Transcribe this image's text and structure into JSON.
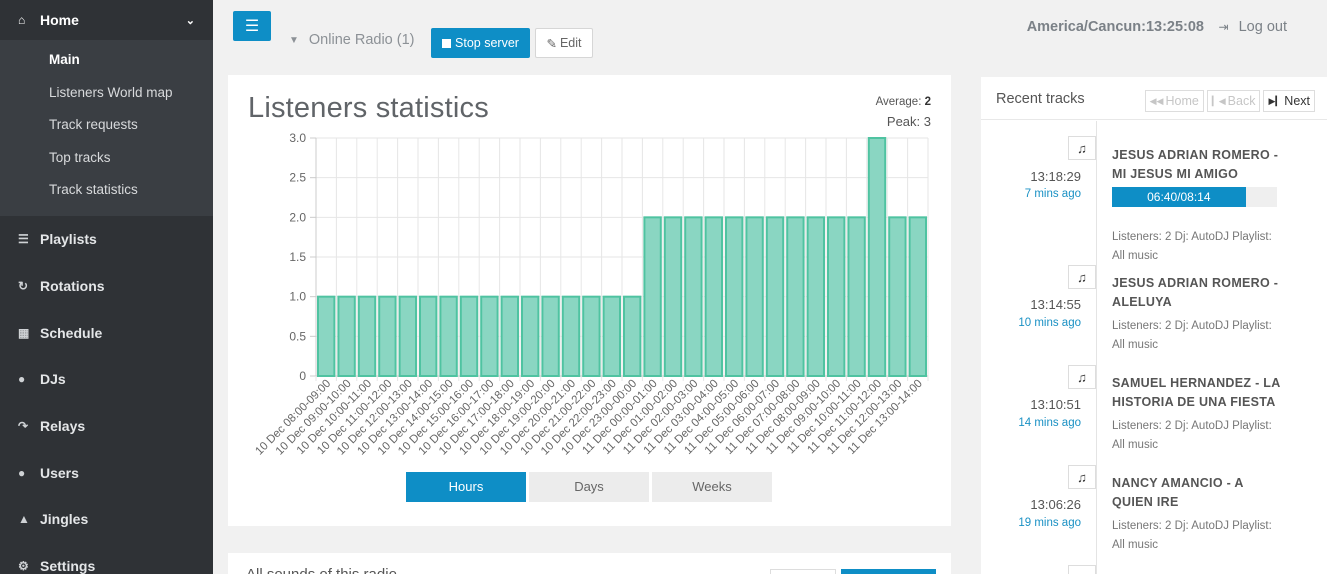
{
  "sidebar": {
    "home_label": "Home",
    "sub_items": [
      {
        "label": "Main"
      },
      {
        "label": "Listeners World map"
      },
      {
        "label": "Track requests"
      },
      {
        "label": "Top tracks"
      },
      {
        "label": "Track statistics"
      }
    ],
    "items": [
      {
        "label": "Playlists",
        "icon": "list-icon"
      },
      {
        "label": "Rotations",
        "icon": "refresh-icon"
      },
      {
        "label": "Schedule",
        "icon": "calendar-icon"
      },
      {
        "label": "DJs",
        "icon": "user-icon"
      },
      {
        "label": "Relays",
        "icon": "redo-icon"
      },
      {
        "label": "Users",
        "icon": "users-icon"
      },
      {
        "label": "Jingles",
        "icon": "bell-icon"
      },
      {
        "label": "Settings",
        "icon": "gears-icon"
      }
    ]
  },
  "header": {
    "radio_selector": "Online Radio (1)",
    "stop_label": "Stop server",
    "edit_label": "Edit",
    "timezone_clock": "America/Cancun:13:25:08",
    "logout_label": "Log out"
  },
  "stats": {
    "title": "Listeners statistics",
    "average_label": "Average:",
    "average_value": "2",
    "peak_text": "Peak: 3",
    "range_buttons": [
      "Hours",
      "Days",
      "Weeks"
    ],
    "active_range": "Hours"
  },
  "chart_data": {
    "type": "bar",
    "categories": [
      "10 Dec 08:00-09:00",
      "10 Dec 09:00-10:00",
      "10 Dec 10:00-11:00",
      "10 Dec 11:00-12:00",
      "10 Dec 12:00-13:00",
      "10 Dec 13:00-14:00",
      "10 Dec 14:00-15:00",
      "10 Dec 15:00-16:00",
      "10 Dec 16:00-17:00",
      "10 Dec 17:00-18:00",
      "10 Dec 18:00-19:00",
      "10 Dec 19:00-20:00",
      "10 Dec 20:00-21:00",
      "10 Dec 21:00-22:00",
      "10 Dec 22:00-23:00",
      "10 Dec 23:00-00:00",
      "11 Dec 00:00-01:00",
      "11 Dec 01:00-02:00",
      "11 Dec 02:00-03:00",
      "11 Dec 03:00-04:00",
      "11 Dec 04:00-05:00",
      "11 Dec 05:00-06:00",
      "11 Dec 06:00-07:00",
      "11 Dec 07:00-08:00",
      "11 Dec 08:00-09:00",
      "11 Dec 09:00-10:00",
      "11 Dec 10:00-11:00",
      "11 Dec 11:00-12:00",
      "11 Dec 12:00-13:00",
      "11 Dec 13:00-14:00"
    ],
    "values": [
      1,
      1,
      1,
      1,
      1,
      1,
      1,
      1,
      1,
      1,
      1,
      1,
      1,
      1,
      1,
      1,
      2,
      2,
      2,
      2,
      2,
      2,
      2,
      2,
      2,
      2,
      2,
      3,
      2,
      2
    ],
    "yticks": [
      "0",
      "0.5",
      "1.0",
      "1.5",
      "2.0",
      "2.5",
      "3.0"
    ],
    "ylim": [
      0,
      3
    ],
    "grid": true,
    "bar_fill": "#8ad6c2",
    "bar_stroke": "#4fc3a1"
  },
  "lower_panel": {
    "title": "All sounds of this radio"
  },
  "recent": {
    "title": "Recent tracks",
    "nav": [
      {
        "label": "Home",
        "icon": "fast-backward-icon",
        "enabled": false
      },
      {
        "label": "Back",
        "icon": "step-backward-icon",
        "enabled": false
      },
      {
        "label": "Next",
        "icon": "step-forward-icon",
        "enabled": true
      }
    ],
    "tracks": [
      {
        "time": "13:18:29",
        "ago": "7 mins ago",
        "name": "JESUS ADRIAN ROMERO - MI JESUS MI AMIGO",
        "progress_text": "06:40/08:14",
        "progress": 0.81,
        "meta": "Listeners: 2 Dj: AutoDJ Playlist: All music"
      },
      {
        "time": "13:14:55",
        "ago": "10 mins ago",
        "name": "JESUS ADRIAN ROMERO - ALELUYA",
        "meta": "Listeners: 2 Dj: AutoDJ Playlist: All music"
      },
      {
        "time": "13:10:51",
        "ago": "14 mins ago",
        "name": "SAMUEL HERNANDEZ - LA HISTORIA DE UNA FIESTA",
        "meta": "Listeners: 2 Dj: AutoDJ Playlist: All music"
      },
      {
        "time": "13:06:26",
        "ago": "19 mins ago",
        "name": "NANCY AMANCIO - A QUIEN IRE",
        "meta": "Listeners: 2 Dj: AutoDJ Playlist: All music"
      }
    ]
  }
}
